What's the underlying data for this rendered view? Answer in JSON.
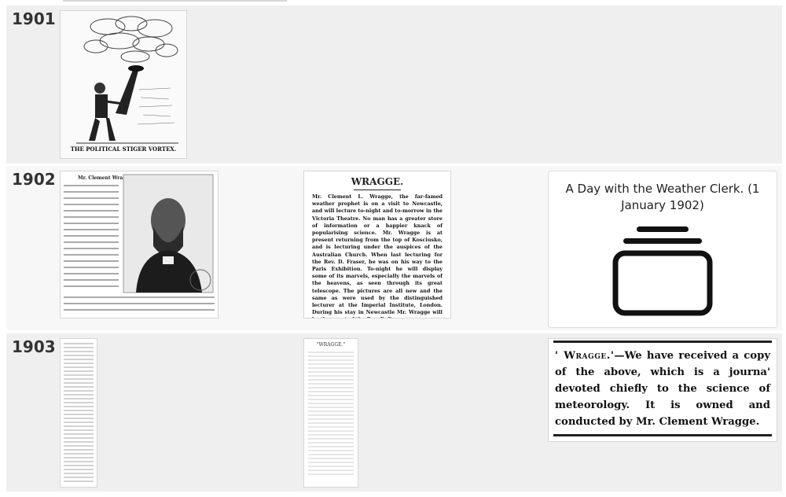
{
  "timeline": [
    {
      "year": "1901",
      "items": [
        {
          "kind": "image",
          "caption": "THE POLITICAL STIGER VORTEX."
        }
      ]
    },
    {
      "year": "1902",
      "items": [
        {
          "kind": "image",
          "heading": "Mr. Clement Wragge."
        },
        {
          "kind": "image",
          "heading": "WRAGGE.",
          "body": "Mr. Clement L. Wragge, the far-famed weather prophet is on a visit to Newcastle, and will lecture to-night and to-morrow in the Victoria Theatre. No man has a greater store of information or a happier knack of popularising science. Mr. Wragge is at present returning from the top of Kosciusko, and is lecturing under the auspices of the Australian Church. When last lecturing for the Rev. D. Fraser, he was on his way to the Paris Exhibition. To-night he will display some of its marvels, especially the marvels of the heavens, as seen through its great telescope. The pictures are all new and the same as were used by the distinguished lecturer at the Imperial Institute, London. During his stay in Newcastle Mr. Wragge will be the guest of the Rev. D. Fraser."
        },
        {
          "kind": "card",
          "title": "A Day with the Weather Clerk. (1 January 1902)",
          "icon": "archive-box-icon"
        }
      ]
    },
    {
      "year": "1903",
      "items": [
        {
          "kind": "image"
        },
        {
          "kind": "image",
          "heading": "\"WRAGGE.\""
        },
        {
          "kind": "image",
          "heading": "' Wragge.'",
          "body": "—We have received a copy of the above, which is a journa' devoted chiefly to the science of meteorology. It is owned and conducted by Mr. Clement Wragge."
        }
      ]
    }
  ]
}
